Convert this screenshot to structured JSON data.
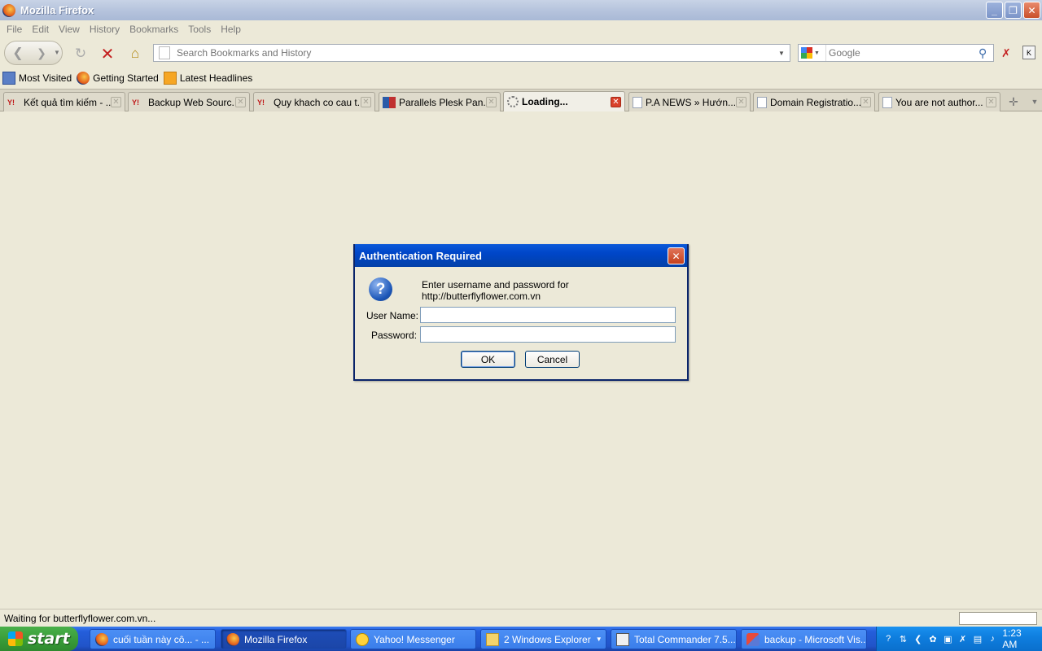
{
  "window": {
    "title": "Mozilla Firefox"
  },
  "menu": [
    "File",
    "Edit",
    "View",
    "History",
    "Bookmarks",
    "Tools",
    "Help"
  ],
  "nav": {
    "url_placeholder": "Search Bookmarks and History",
    "search_placeholder": "Google"
  },
  "bookmarks": [
    "Most Visited",
    "Getting Started",
    "Latest Headlines"
  ],
  "tabs": [
    "Kết quả tìm kiếm - ...",
    "Backup Web Sourc...",
    "Quy khach co cau t...",
    "Parallels Plesk Pan...",
    "Loading...",
    "P.A NEWS » Hướn...",
    "Domain Registratio...",
    "You are not author..."
  ],
  "dialog": {
    "title": "Authentication Required",
    "message": "Enter username and password for http://butterflyflower.com.vn",
    "username_label": "User Name:",
    "password_label": "Password:",
    "username_value": "",
    "password_value": "",
    "ok_label": "OK",
    "cancel_label": "Cancel"
  },
  "status": {
    "text": "Waiting for butterflyflower.com.vn..."
  },
  "taskbar": {
    "start_label": "start",
    "items": [
      "cuối tuần này cô... - ...",
      "Mozilla Firefox",
      "Yahoo! Messenger",
      "2 Windows Explorer",
      "Total Commander 7.5...",
      "backup - Microsoft Vis..."
    ],
    "clock": "1:23 AM"
  }
}
